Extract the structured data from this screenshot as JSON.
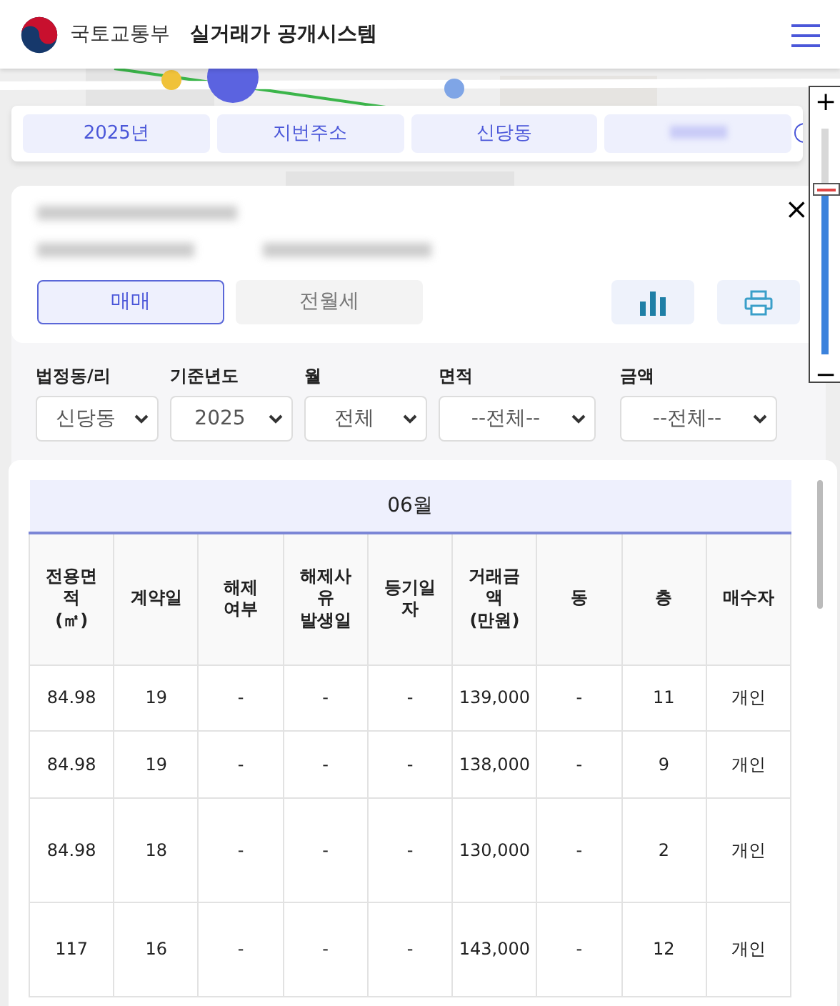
{
  "header": {
    "ministry": "국토교통부",
    "system": "실거래가 공개시스템"
  },
  "chips": [
    {
      "kind": "text",
      "label": "2025년"
    },
    {
      "kind": "text",
      "label": "지번주소"
    },
    {
      "kind": "text",
      "label": "신당동"
    },
    {
      "kind": "redacted"
    }
  ],
  "zoom": {
    "plus": "+",
    "minus": "−",
    "level": 0.7
  },
  "detail": {
    "close": "×",
    "tabs": [
      {
        "label": "매매",
        "selected": true
      },
      {
        "label": "전월세",
        "selected": false
      }
    ]
  },
  "filters": [
    {
      "label": "법정동/리",
      "value": "신당동"
    },
    {
      "label": "기준년도",
      "value": "2025"
    },
    {
      "label": "월",
      "value": "전체"
    },
    {
      "label": "면적",
      "value": "--전체--"
    },
    {
      "label": "금액",
      "value": "--전체--"
    }
  ],
  "table": {
    "month": "06월",
    "columns": [
      "전용면\n적\n(㎡)",
      "계약일",
      "해제\n여부",
      "해제사\n유\n발생일",
      "등기일\n자",
      "거래금\n액\n(만원)",
      "동",
      "층",
      "매수자"
    ],
    "rows": [
      [
        "84.98",
        "19",
        "-",
        "-",
        "-",
        "139,000",
        "-",
        "11",
        "개인"
      ],
      [
        "84.98",
        "19",
        "-",
        "-",
        "-",
        "138,000",
        "-",
        "9",
        "개인"
      ],
      [
        "84.98",
        "18",
        "-",
        "-",
        "-",
        "130,000",
        "-",
        "2",
        "개인"
      ],
      [
        "117",
        "16",
        "-",
        "-",
        "-",
        "143,000",
        "-",
        "12",
        "개인"
      ]
    ]
  }
}
